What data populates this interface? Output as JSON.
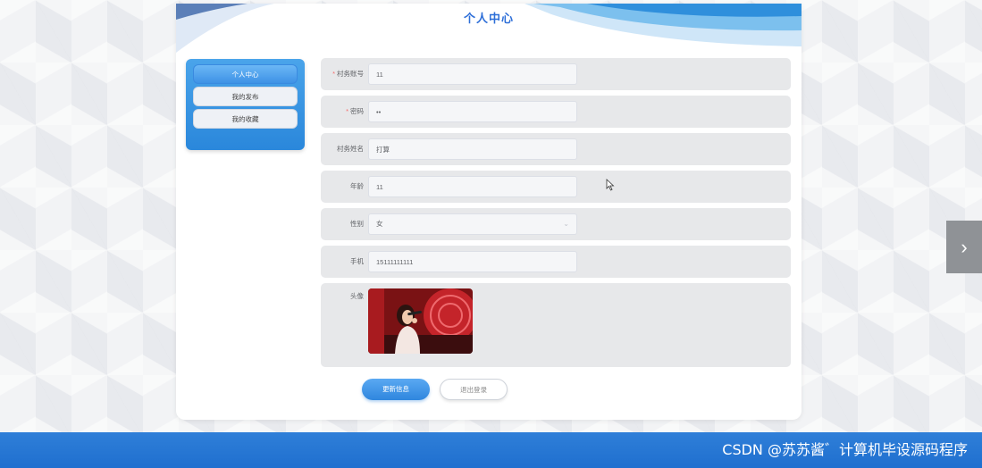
{
  "page": {
    "title": "个人中心"
  },
  "sidebar": {
    "items": [
      {
        "label": "个人中心",
        "active": true
      },
      {
        "label": "我的发布",
        "active": false
      },
      {
        "label": "我的收藏",
        "active": false
      }
    ]
  },
  "form": {
    "account": {
      "label": "村务账号",
      "required": true,
      "value": "11"
    },
    "password": {
      "label": "密码",
      "required": true,
      "value": "••"
    },
    "name": {
      "label": "村务姓名",
      "required": false,
      "value": "打算"
    },
    "age": {
      "label": "年龄",
      "required": false,
      "value": "11"
    },
    "gender": {
      "label": "性别",
      "required": false,
      "value": "女"
    },
    "phone": {
      "label": "手机",
      "required": false,
      "value": "15111111111"
    },
    "avatar": {
      "label": "头像"
    }
  },
  "actions": {
    "update_label": "更新信息",
    "logout_label": "退出登录"
  },
  "footer": {
    "watermark": "CSDN @苏苏酱゛计算机毕设源码程序"
  },
  "colors": {
    "accent": "#2f86de",
    "footer": "#1f6fcf",
    "required": "#f56c6c"
  },
  "icons": {
    "next": "chevron-right-icon",
    "select": "chevron-down-icon",
    "pointer": "mouse-cursor-icon"
  }
}
